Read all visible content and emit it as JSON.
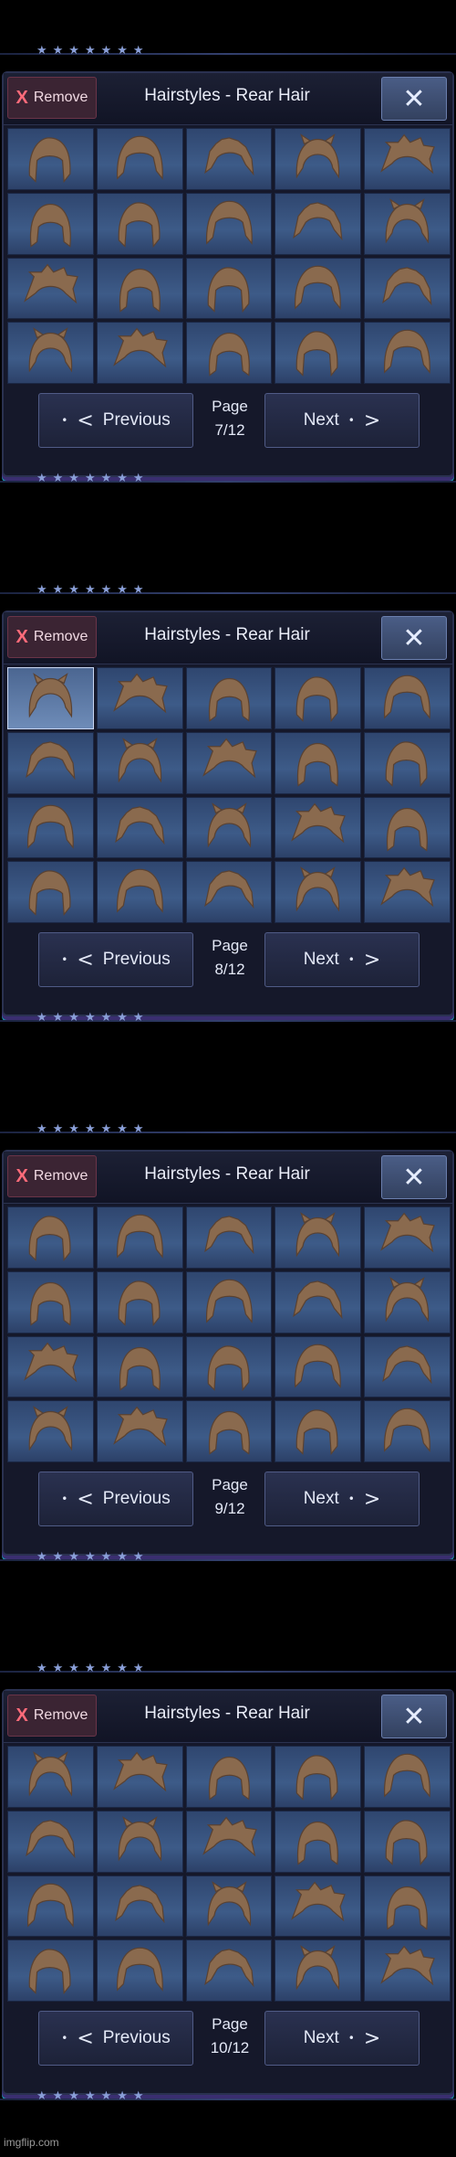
{
  "stars": "★★★★★★★",
  "remove_x": "X",
  "remove_label": "Remove",
  "title": "Hairstyles - Rear Hair",
  "close_glyph": "✕",
  "prev_glyph": "<",
  "next_glyph": ">",
  "dot_glyph": "•",
  "previous_label": "Previous",
  "next_label": "Next",
  "page_word": "Page",
  "hair_color": "#8a6a4e",
  "pages": [
    {
      "page": "7/12",
      "selected": []
    },
    {
      "page": "8/12",
      "selected": [
        0
      ]
    },
    {
      "page": "9/12",
      "selected": []
    },
    {
      "page": "10/12",
      "selected": []
    }
  ],
  "footer": "imgflip.com"
}
